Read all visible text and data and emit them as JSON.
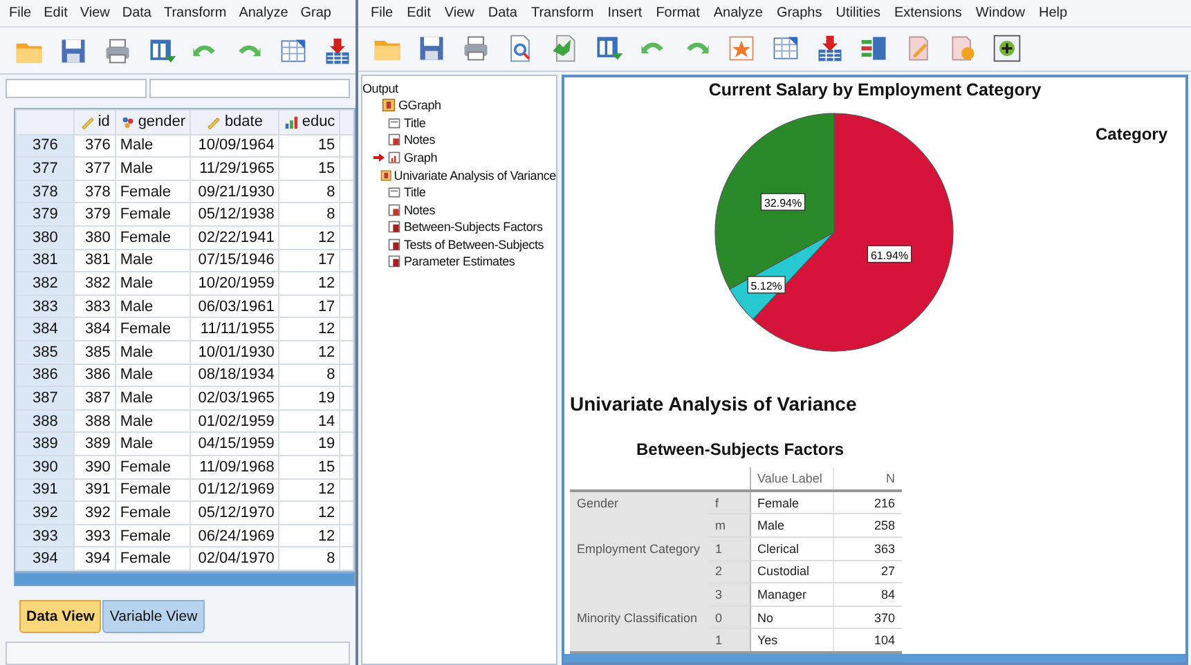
{
  "data_editor": {
    "menu": [
      "File",
      "Edit",
      "View",
      "Data",
      "Transform",
      "Analyze",
      "Grap"
    ],
    "columns": [
      {
        "name": "id",
        "kind": "scale"
      },
      {
        "name": "gender",
        "kind": "nominal"
      },
      {
        "name": "bdate",
        "kind": "scale"
      },
      {
        "name": "educ",
        "kind": "ordinal"
      }
    ],
    "rows": [
      {
        "case": "376",
        "cells": [
          "376",
          "Male",
          "10/09/1964",
          "15"
        ]
      },
      {
        "case": "377",
        "cells": [
          "377",
          "Male",
          "11/29/1965",
          "15"
        ]
      },
      {
        "case": "378",
        "cells": [
          "378",
          "Female",
          "09/21/1930",
          "8"
        ]
      },
      {
        "case": "379",
        "cells": [
          "379",
          "Female",
          "05/12/1938",
          "8"
        ]
      },
      {
        "case": "380",
        "cells": [
          "380",
          "Female",
          "02/22/1941",
          "12"
        ]
      },
      {
        "case": "381",
        "cells": [
          "381",
          "Male",
          "07/15/1946",
          "17"
        ]
      },
      {
        "case": "382",
        "cells": [
          "382",
          "Male",
          "10/20/1959",
          "12"
        ]
      },
      {
        "case": "383",
        "cells": [
          "383",
          "Male",
          "06/03/1961",
          "17"
        ]
      },
      {
        "case": "384",
        "cells": [
          "384",
          "Female",
          "11/11/1955",
          "12"
        ]
      },
      {
        "case": "385",
        "cells": [
          "385",
          "Male",
          "10/01/1930",
          "12"
        ]
      },
      {
        "case": "386",
        "cells": [
          "386",
          "Male",
          "08/18/1934",
          "8"
        ]
      },
      {
        "case": "387",
        "cells": [
          "387",
          "Male",
          "02/03/1965",
          "19"
        ]
      },
      {
        "case": "388",
        "cells": [
          "388",
          "Male",
          "01/02/1959",
          "14"
        ]
      },
      {
        "case": "389",
        "cells": [
          "389",
          "Male",
          "04/15/1959",
          "19"
        ]
      },
      {
        "case": "390",
        "cells": [
          "390",
          "Female",
          "11/09/1968",
          "15"
        ]
      },
      {
        "case": "391",
        "cells": [
          "391",
          "Female",
          "01/12/1969",
          "12"
        ]
      },
      {
        "case": "392",
        "cells": [
          "392",
          "Female",
          "05/12/1970",
          "12"
        ]
      },
      {
        "case": "393",
        "cells": [
          "393",
          "Female",
          "06/24/1969",
          "12"
        ]
      },
      {
        "case": "394",
        "cells": [
          "394",
          "Female",
          "02/04/1970",
          "8"
        ]
      }
    ],
    "tabs": [
      {
        "label": "Data View",
        "selected": true
      },
      {
        "label": "Variable View",
        "selected": false
      }
    ]
  },
  "viewer": {
    "menu": [
      "File",
      "Edit",
      "View",
      "Data",
      "Transform",
      "Insert",
      "Format",
      "Analyze",
      "Graphs",
      "Utilities",
      "Extensions",
      "Window",
      "Help"
    ],
    "outline": {
      "label": "Output",
      "children": [
        {
          "label": "GGraph",
          "kind": "log",
          "selected": false,
          "children": [
            {
              "label": "Title",
              "kind": "title",
              "selected": false
            },
            {
              "label": "Notes",
              "kind": "notes",
              "selected": false
            },
            {
              "label": "Graph",
              "kind": "graph",
              "selected": true
            }
          ]
        },
        {
          "label": "Univariate Analysis of Variance",
          "kind": "log",
          "selected": false,
          "children": [
            {
              "label": "Title",
              "kind": "title",
              "selected": false
            },
            {
              "label": "Notes",
              "kind": "notes",
              "selected": false
            },
            {
              "label": "Between-Subjects Factors",
              "kind": "table",
              "selected": false
            },
            {
              "label": "Tests of Between-Subjects",
              "kind": "table",
              "selected": false
            },
            {
              "label": "Parameter Estimates",
              "kind": "table",
              "selected": false
            }
          ]
        }
      ]
    },
    "chart": {
      "legend_title": "Category",
      "chart_data": {
        "type": "pie",
        "title": "Current Salary by Employment Category",
        "values": [
          61.94,
          5.12,
          32.94
        ],
        "value_labels": [
          "61.94%",
          "5.12%",
          "32.94%"
        ]
      }
    },
    "section_title": "Univariate Analysis of Variance",
    "factors_table": {
      "title": "Between-Subjects Factors",
      "columns": [
        "Value Label",
        "N"
      ],
      "factors": [
        {
          "name": "Gender",
          "levels": [
            {
              "value": "f",
              "label": "Female",
              "n": "216"
            },
            {
              "value": "m",
              "label": "Male",
              "n": "258"
            }
          ]
        },
        {
          "name": "Employment Category",
          "levels": [
            {
              "value": "1",
              "label": "Clerical",
              "n": "363"
            },
            {
              "value": "2",
              "label": "Custodial",
              "n": "27"
            },
            {
              "value": "3",
              "label": "Manager",
              "n": "84"
            }
          ]
        },
        {
          "name": "Minority Classification",
          "levels": [
            {
              "value": "0",
              "label": "No",
              "n": "370"
            },
            {
              "value": "1",
              "label": "Yes",
              "n": "104"
            }
          ]
        }
      ]
    }
  }
}
